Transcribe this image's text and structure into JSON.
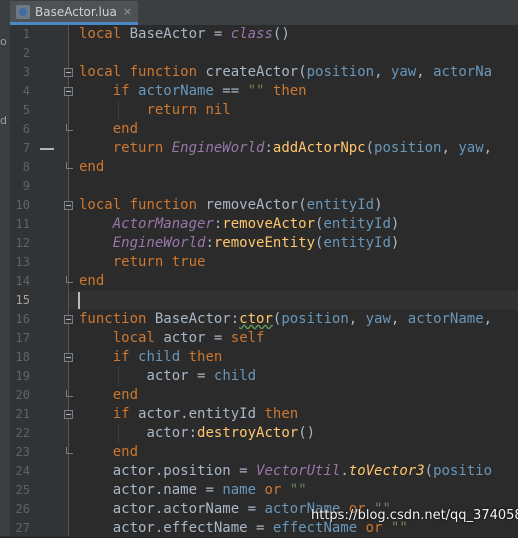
{
  "tab": {
    "filename": "BaseActor.lua",
    "close": "×"
  },
  "left_fragments": [
    "o",
    "d"
  ],
  "current_line": 15,
  "lines": [
    {
      "n": "1"
    },
    {
      "n": "2"
    },
    {
      "n": "3"
    },
    {
      "n": "4"
    },
    {
      "n": "5"
    },
    {
      "n": "6"
    },
    {
      "n": "7"
    },
    {
      "n": "8"
    },
    {
      "n": "9"
    },
    {
      "n": "10"
    },
    {
      "n": "11"
    },
    {
      "n": "12"
    },
    {
      "n": "13"
    },
    {
      "n": "14"
    },
    {
      "n": "15"
    },
    {
      "n": "16"
    },
    {
      "n": "17"
    },
    {
      "n": "18"
    },
    {
      "n": "19"
    },
    {
      "n": "20"
    },
    {
      "n": "21"
    },
    {
      "n": "22"
    },
    {
      "n": "23"
    },
    {
      "n": "24"
    },
    {
      "n": "25"
    },
    {
      "n": "26"
    },
    {
      "n": "27"
    }
  ],
  "tokens": {
    "local": "local",
    "function": "function",
    "if": "if",
    "then": "then",
    "return": "return",
    "end": "end",
    "nil": "nil",
    "true": "true",
    "or": "or",
    "self": "self",
    "class": "class",
    "BaseActor": "BaseActor",
    "createActor": "createActor",
    "removeActor": "removeActor",
    "position": "position",
    "yaw": "yaw",
    "actorName_trunc": "actorNa",
    "actorName": "actorName",
    "emptyStr": "\"\"",
    "EngineWorld": "EngineWorld",
    "addActorNpc": "addActorNpc",
    "entityId": "entityId",
    "ActorManager": "ActorManager",
    "removeEntity": "removeEntity",
    "ctor": "ctor",
    "actor": "actor",
    "child": "child",
    "destroyActor": "destroyActor",
    "VectorUtil": "VectorUtil",
    "toVector3": "toVector3",
    "positio_trunc": "positio",
    "name": "name",
    "effectName": "effectName",
    "actorEntityId": "actor.entityId",
    "actorPosition": "actor.position",
    "actorDotName": "actor.name",
    "actorDotActorName": "actor.actorName",
    "actorDotEffectName": "actor.effectName"
  },
  "watermark": "https://blog.csdn.net/qq_37405874",
  "colors": {
    "background": "#2b2b2b",
    "gutter": "#313335",
    "keyword": "#cc7832",
    "string": "#6a8759",
    "parameter": "#6897bb",
    "global": "#9876aa",
    "method": "#ffc66d",
    "text": "#a9b7c6"
  }
}
